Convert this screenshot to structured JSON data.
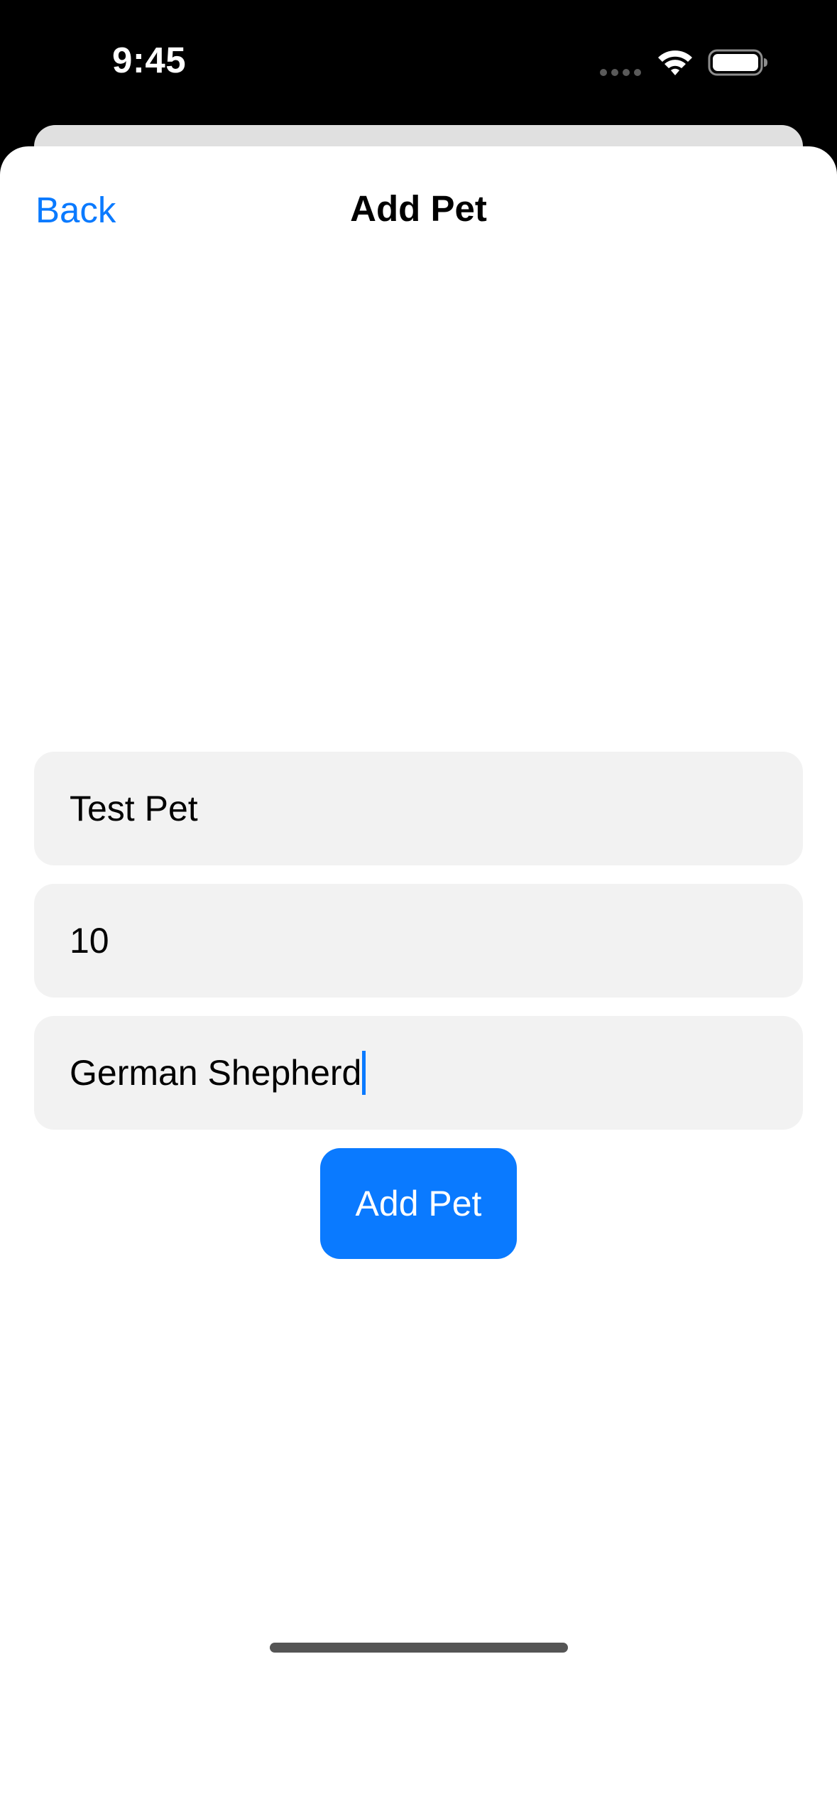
{
  "status_bar": {
    "time": "9:45",
    "icons": [
      "cellular-dots-icon",
      "wifi-icon",
      "battery-icon"
    ]
  },
  "nav": {
    "back_label": "Back",
    "title": "Add Pet"
  },
  "form": {
    "name_value": "Test Pet",
    "age_value": "10",
    "breed_value": "German Shepherd",
    "submit_label": "Add Pet"
  },
  "colors": {
    "accent": "#0a7aff",
    "field_background": "#f2f2f2",
    "status_bar_background": "#000000"
  }
}
